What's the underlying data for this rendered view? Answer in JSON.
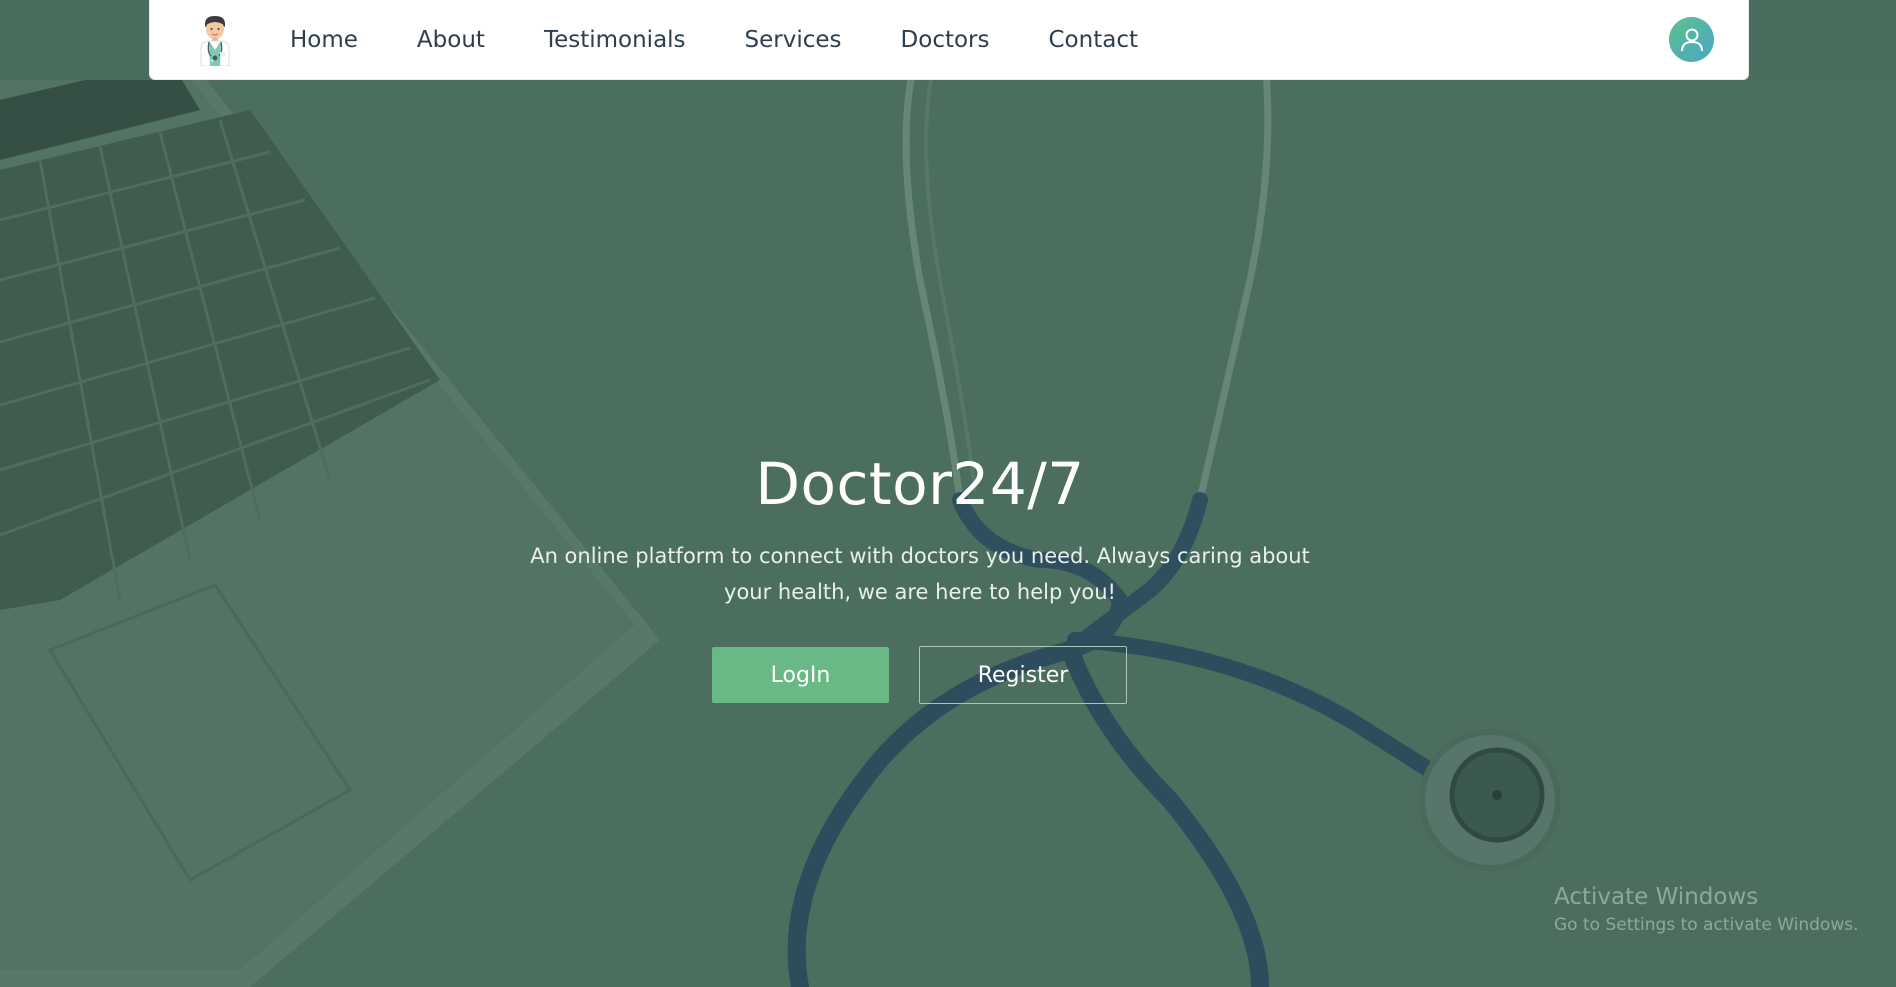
{
  "nav": {
    "logo_icon": "doctor-logo-icon",
    "links": [
      "Home",
      "About",
      "Testimonials",
      "Services",
      "Doctors",
      "Contact"
    ],
    "avatar_icon": "user-icon"
  },
  "hero": {
    "title": "Doctor24/7",
    "subtitle": "An online platform to connect with doctors you need. Always caring about your health, we are here to help you!",
    "login_label": "LogIn",
    "register_label": "Register",
    "background_image": "laptop-and-stethoscope-photo"
  },
  "watermark": {
    "title": "Activate Windows",
    "subtitle": "Go to Settings to activate Windows."
  },
  "colors": {
    "overlay": "#4a6d5e",
    "accent": "#68b985",
    "nav_text": "#2f3e4e"
  }
}
